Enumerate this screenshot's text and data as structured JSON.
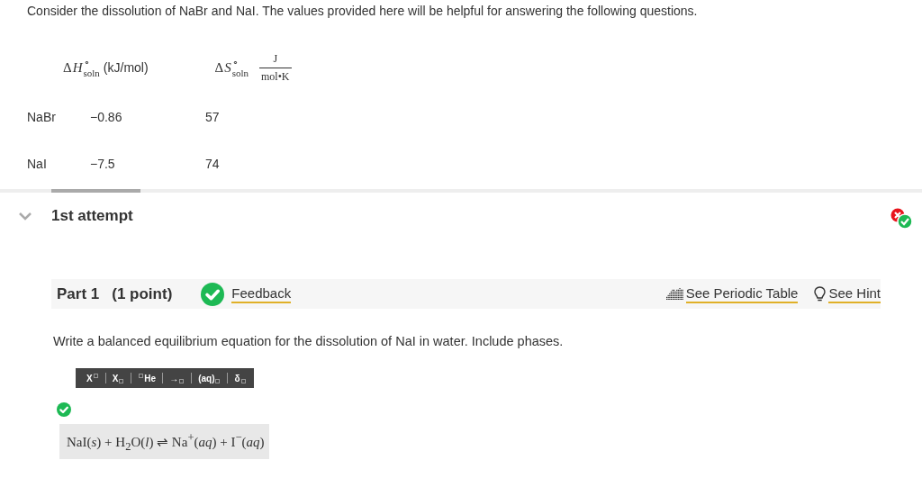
{
  "question": "Consider the dissolution of NaBr and NaI. The values provided here will be helpful for answering the following questions.",
  "table": {
    "columns": [
      {
        "delta": "Δ",
        "symbol": "H",
        "sup": "∘",
        "sub": "soln",
        "unit": "(kJ/mol)"
      },
      {
        "delta": "Δ",
        "symbol": "S",
        "sup": "∘",
        "sub": "soln",
        "unit_numerator": "J",
        "unit_denominator": "mol•K"
      }
    ],
    "rows": [
      {
        "name": "NaBr",
        "cells": [
          "−0.86",
          "57"
        ]
      },
      {
        "name": "NaI",
        "cells": [
          "−7.5",
          "74"
        ]
      }
    ]
  },
  "attempt": {
    "title": "1st attempt",
    "expanded": true,
    "first_try_correct": false,
    "correct": true
  },
  "part": {
    "title": "Part 1",
    "points": "(1 point)",
    "correct": true,
    "feedback": "Feedback",
    "links": [
      {
        "kind": "table",
        "label": "See Periodic Table"
      },
      {
        "kind": "hint",
        "label": "See Hint"
      }
    ]
  },
  "instruction": "Write a balanced equilibrium equation for the dissolution of NaI in water. Include phases.",
  "toolbar": [
    {
      "kind": "sup",
      "label": "X"
    },
    {
      "kind": "sub",
      "label": "X"
    },
    {
      "kind": "iso",
      "label": "He"
    },
    {
      "kind": "sub",
      "label": "→"
    },
    {
      "kind": "sub",
      "label": "(aq)"
    },
    {
      "kind": "sub",
      "label": "δ"
    }
  ],
  "answer": {
    "correct": true,
    "equation": "NaI(*s*) + H$_{2}$O(*l*) ⇌ Na$^{+}$(*aq*) + I$^{−}$(*aq*)"
  }
}
